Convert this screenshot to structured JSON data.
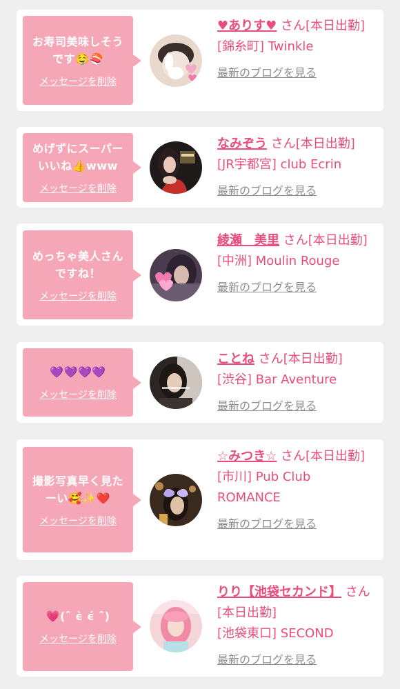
{
  "messages": [
    {
      "text": "お寿司美味しそう\nです🤤🍣",
      "delete_label": "メッセージを削除",
      "name": "♥ありす♥",
      "suffix": " さん[本日出勤]",
      "shop": "[錦糸町] Twinkle",
      "blog_label": "最新のブログを見る",
      "avatar_icon": "bunny-avatar-icon",
      "avatar_colors": [
        "#e9d9cc",
        "#c9b7a8"
      ]
    },
    {
      "text": "めげずにスーパー\nいいね👍www",
      "delete_label": "メッセージを削除",
      "name": "なみぞう",
      "suffix": " さん[本日出勤]",
      "shop": "[JR宇都宮] club Ecrin",
      "blog_label": "最新のブログを見る",
      "avatar_icon": "profile-photo-icon",
      "avatar_colors": [
        "#1f1a1a",
        "#c4302b"
      ]
    },
    {
      "text": "めっちゃ美人さん\nですね！",
      "delete_label": "メッセージを削除",
      "name": "綾瀬　美里",
      "suffix": " さん[本日出勤]",
      "shop": "[中洲] Moulin Rouge",
      "blog_label": "最新のブログを見る",
      "avatar_icon": "hearts-photo-icon",
      "avatar_colors": [
        "#5a4a5e",
        "#f27bb0"
      ]
    },
    {
      "text": "💜💜💜💜",
      "delete_label": "メッセージを削除",
      "name": "ことね",
      "suffix": " さん[本日出勤]",
      "shop": "[渋谷] Bar Aventure",
      "blog_label": "最新のブログを見る",
      "avatar_icon": "selfie-photo-icon",
      "avatar_colors": [
        "#2b2623",
        "#8a7466"
      ]
    },
    {
      "text": "撮影写真早く見た\nーい🥰✨❤️",
      "delete_label": "メッセージを削除",
      "name": "☆みつき☆",
      "suffix": " さん[本日出勤]",
      "shop": "[市川] Pub Club ROMANCE",
      "blog_label": "最新のブログを見る",
      "avatar_icon": "butterfly-photo-icon",
      "avatar_colors": [
        "#3a2a1e",
        "#d6a05a"
      ]
    },
    {
      "text": "💗(ˆ ϵ̀ ϵ́ ˆ)",
      "delete_label": "メッセージを削除",
      "name": "りり【池袋セカンド】",
      "suffix": " さん[本日出勤]",
      "shop": "[池袋東口] SECOND",
      "blog_label": "最新のブログを見る",
      "avatar_icon": "pink-hair-photo-icon",
      "avatar_colors": [
        "#f4d6d9",
        "#f08aa5"
      ]
    }
  ],
  "colors": {
    "bubble": "#f6a7b7",
    "accent": "#e94d7c",
    "muted": "#8c8c8c",
    "background": "#efefef",
    "card": "#ffffff"
  }
}
